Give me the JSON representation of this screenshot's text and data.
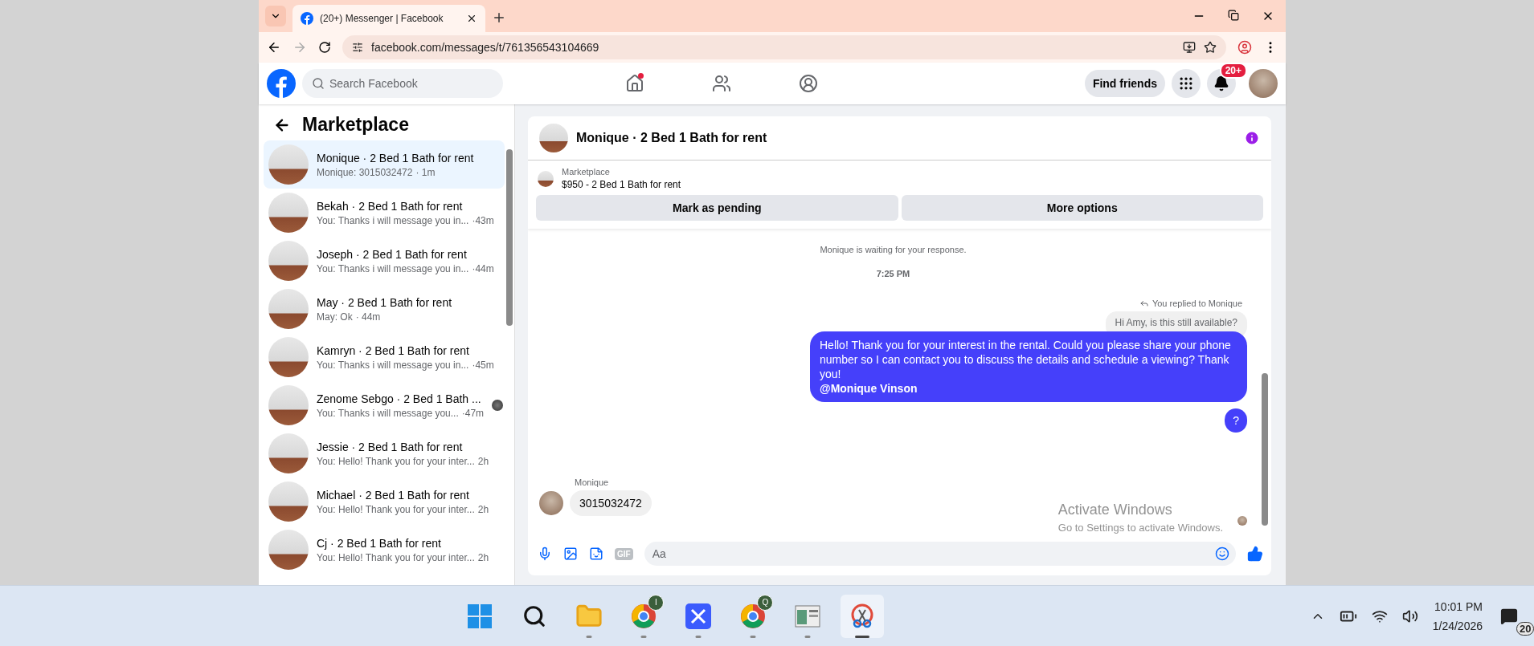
{
  "browser": {
    "tab_title": "(20+) Messenger | Facebook",
    "url": "facebook.com/messages/t/761356543104669"
  },
  "header": {
    "search_placeholder": "Search Facebook",
    "nav": [
      {
        "kind": "home",
        "has_dot": true
      },
      {
        "kind": "friends",
        "has_dot": false
      },
      {
        "kind": "groups",
        "has_dot": false
      }
    ],
    "find_friends": "Find friends",
    "notification_count": "20+"
  },
  "sidebar": {
    "title": "Marketplace",
    "conversations": [
      {
        "title": "Monique · 2 Bed 1 Bath for rent",
        "preview": "Monique: 3015032472",
        "time": "· 1m",
        "selected": true,
        "seen_avatar": false
      },
      {
        "title": "Bekah · 2 Bed 1 Bath for rent",
        "preview": "You: Thanks i will message you in...",
        "time": "·43m",
        "selected": false,
        "seen_avatar": false
      },
      {
        "title": "Joseph · 2 Bed 1 Bath for rent",
        "preview": "You: Thanks i will message you in...",
        "time": "·44m",
        "selected": false,
        "seen_avatar": false
      },
      {
        "title": "May · 2 Bed 1 Bath for rent",
        "preview": "May: Ok",
        "time": "· 44m",
        "selected": false,
        "seen_avatar": false
      },
      {
        "title": "Kamryn · 2 Bed 1 Bath for rent",
        "preview": "You: Thanks i will message you in...",
        "time": "·45m",
        "selected": false,
        "seen_avatar": false
      },
      {
        "title": "Zenome Sebgo · 2 Bed 1 Bath ...",
        "preview": "You: Thanks i will message you...",
        "time": "·47m",
        "selected": false,
        "seen_avatar": true
      },
      {
        "title": "Jessie · 2 Bed 1 Bath for rent",
        "preview": "You: Hello! Thank you for your inter...",
        "time": "2h",
        "selected": false,
        "seen_avatar": false
      },
      {
        "title": "Michael · 2 Bed 1 Bath for rent",
        "preview": "You: Hello! Thank you for your inter...",
        "time": "2h",
        "selected": false,
        "seen_avatar": false
      },
      {
        "title": "Cj · 2 Bed 1 Bath for rent",
        "preview": "You: Hello! Thank you for your inter...",
        "time": "2h",
        "selected": false,
        "seen_avatar": false
      }
    ]
  },
  "chat": {
    "title": "Monique · 2 Bed 1 Bath for rent",
    "listing": {
      "label": "Marketplace",
      "summary": "$950 - 2 Bed 1 Bath for rent"
    },
    "actions": [
      "Mark as pending",
      "More options"
    ],
    "messages": [
      {
        "kind": "system",
        "text": "Monique is waiting for your response."
      },
      {
        "kind": "timestamp",
        "text": "7:25 PM"
      },
      {
        "kind": "reply_note",
        "text": "You replied to Monique"
      },
      {
        "kind": "quoted",
        "text": "Hi Amy, is this still available?"
      },
      {
        "kind": "outgoing",
        "text": "Hello! Thank you for your interest in the rental. Could you please share your phone number so I can contact you to discuss the details and schedule a viewing? Thank you!",
        "mention": "@Monique Vinson"
      },
      {
        "kind": "outgoing",
        "text": "?"
      },
      {
        "kind": "sender",
        "text": "Monique"
      },
      {
        "kind": "incoming",
        "text": "3015032472"
      }
    ],
    "composer": {
      "gif_label": "GIF",
      "placeholder": "Aa"
    }
  },
  "os_notice": {
    "title": "Activate Windows",
    "subtitle": "Go to Settings to activate Windows."
  },
  "taskbar": {
    "apps": [
      {
        "kind": "start",
        "active": false
      },
      {
        "kind": "search",
        "active": false
      },
      {
        "kind": "files",
        "active": false
      },
      {
        "kind": "chrome",
        "badge": "I",
        "active": false
      },
      {
        "kind": "app",
        "active": false
      },
      {
        "kind": "chrome",
        "badge": "Q",
        "active": false
      },
      {
        "kind": "window",
        "active": false
      },
      {
        "kind": "snip",
        "active": true
      }
    ],
    "time": "10:01 PM",
    "date": "1/24/2026",
    "notifications": "20"
  }
}
